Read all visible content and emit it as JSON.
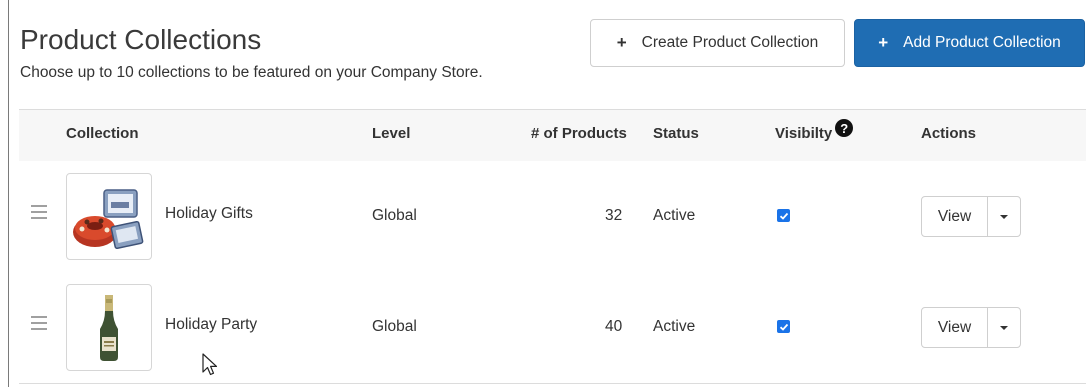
{
  "header": {
    "title": "Product Collections",
    "subtitle": "Choose up to 10 collections to be featured on your Company Store.",
    "create_button": {
      "icon": "plus-icon",
      "label": "Create Product Collection"
    },
    "add_button": {
      "icon": "plus-icon",
      "label": "Add Product Collection",
      "color": "#1f6db3"
    }
  },
  "table": {
    "columns": {
      "collection": "Collection",
      "level": "Level",
      "products": "# of Products",
      "status": "Status",
      "visibility": "Visibilty",
      "actions": "Actions"
    },
    "visibility_help_icon": "?",
    "rows": [
      {
        "name": "Holiday Gifts",
        "level": "Global",
        "products": "32",
        "status": "Active",
        "visible": true,
        "thumb_icon": "gift-basket-image",
        "action_label": "View"
      },
      {
        "name": "Holiday Party",
        "level": "Global",
        "products": "40",
        "status": "Active",
        "visible": true,
        "thumb_icon": "champagne-bottle-image",
        "action_label": "View"
      }
    ]
  },
  "colors": {
    "accent": "#1f6db3",
    "checkbox": "#1a73e8"
  }
}
